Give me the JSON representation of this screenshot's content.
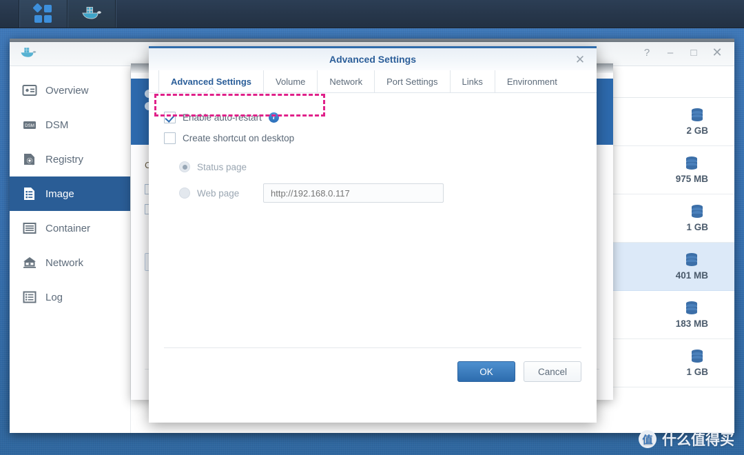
{
  "taskbar": {
    "main_menu_icon": "synology-squares-icon",
    "docker_icon": "docker-whale-icon"
  },
  "app_window": {
    "app_icon": "docker-whale-icon",
    "controls": [
      {
        "name": "help",
        "glyph": "?"
      },
      {
        "name": "minimize",
        "glyph": "–"
      },
      {
        "name": "maximize",
        "glyph": "□"
      },
      {
        "name": "close",
        "glyph": "✕"
      }
    ],
    "sidebar": {
      "items": [
        {
          "label": "Overview",
          "icon": "overview-card-icon",
          "active": false
        },
        {
          "label": "DSM",
          "icon": "dsm-badge-icon",
          "active": false
        },
        {
          "label": "Registry",
          "icon": "registry-search-icon",
          "active": false
        },
        {
          "label": "Image",
          "icon": "image-document-icon",
          "active": true
        },
        {
          "label": "Container",
          "icon": "container-box-icon",
          "active": false
        },
        {
          "label": "Network",
          "icon": "network-house-icon",
          "active": false
        },
        {
          "label": "Log",
          "icon": "log-list-icon",
          "active": false
        }
      ]
    },
    "image_list": {
      "rows": [
        {
          "size": "2 GB",
          "selected": false
        },
        {
          "size": "975 MB",
          "selected": false
        },
        {
          "size": "1 GB",
          "selected": false
        },
        {
          "size": "401 MB",
          "selected": true
        },
        {
          "size": "183 MB",
          "selected": false
        },
        {
          "size": "1 GB",
          "selected": false
        }
      ]
    }
  },
  "dialog": {
    "title": "Advanced Settings",
    "close_glyph": "✕",
    "tabs": [
      {
        "label": "Advanced Settings",
        "active": true
      },
      {
        "label": "Volume",
        "active": false
      },
      {
        "label": "Network",
        "active": false
      },
      {
        "label": "Port Settings",
        "active": false
      },
      {
        "label": "Links",
        "active": false
      },
      {
        "label": "Environment",
        "active": false
      }
    ],
    "options": {
      "auto_restart": {
        "label": "Enable auto-restart",
        "checked": true,
        "info_icon": "info-circle-icon"
      },
      "shortcut": {
        "label": "Create shortcut on desktop",
        "checked": false
      }
    },
    "shortcut_target": {
      "status_page": {
        "label": "Status page",
        "selected": true
      },
      "web_page": {
        "label": "Web page",
        "selected": false,
        "url_placeholder": "http://192.168.0.117",
        "url_value": ""
      }
    },
    "footer": {
      "ok_label": "OK",
      "cancel_label": "Cancel"
    },
    "accent_color": "#2b5e99",
    "primary_button_color": "#2d6cae"
  },
  "annotation": {
    "target": "Enable auto-restart",
    "color": "#e0218a",
    "style": "dashed-rectangle"
  },
  "watermark": {
    "badge": "值",
    "text": "什么值得买"
  }
}
